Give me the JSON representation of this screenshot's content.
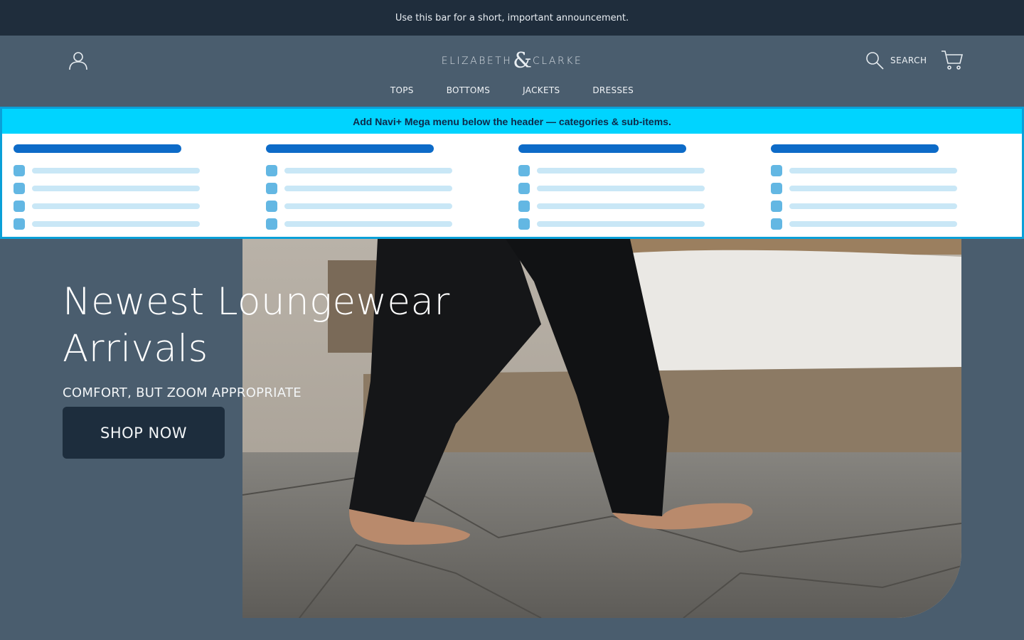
{
  "announcement": {
    "text": "Use this bar for a short, important announcement."
  },
  "header": {
    "logo": {
      "left": "ELIZABETH",
      "amp": "&",
      "right": "CLARKE"
    },
    "search_label": "SEARCH",
    "nav": [
      {
        "label": "TOPS"
      },
      {
        "label": "BOTTOMS"
      },
      {
        "label": "JACKETS"
      },
      {
        "label": "DRESSES"
      }
    ]
  },
  "mega_menu": {
    "banner": "Add Navi+ Mega menu below the header — categories & sub-items.",
    "columns": 4,
    "items_per_column": 4,
    "colors": {
      "heading": "#0d6bc8",
      "icon": "#63b7e3",
      "item": "#c9e7f6",
      "banner": "#00d4ff"
    }
  },
  "hero": {
    "title_line1": "Newest Loungewear",
    "title_line2": "Arrivals",
    "subtitle": "COMFORT, BUT ZOOM APPROPRIATE",
    "cta": "SHOP NOW"
  },
  "colors": {
    "header_bg": "#4a5d6e",
    "announcement_bg": "#1f2d3c",
    "cta_bg": "#1d2d3d"
  }
}
